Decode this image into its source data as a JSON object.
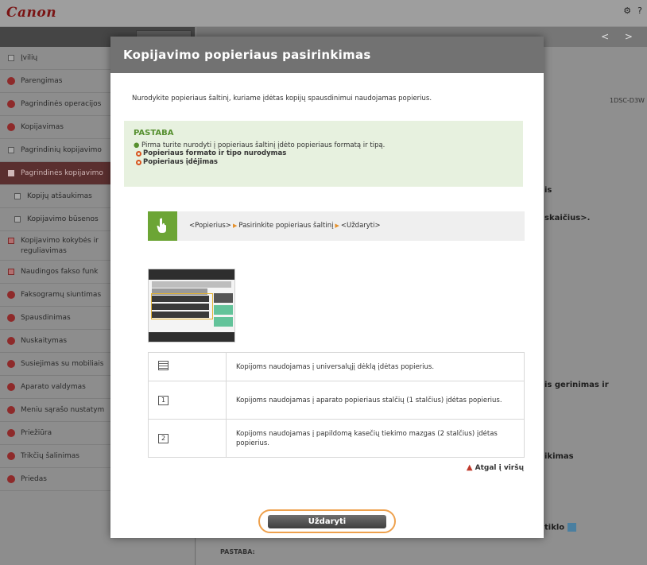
{
  "header": {
    "logo": "Canon",
    "settings_icon": "gear-icon",
    "help_label": "?"
  },
  "sidebar": {
    "items": [
      {
        "label": "Įvilių"
      },
      {
        "label": "Parengimas"
      },
      {
        "label": "Pagrindinės operacijos"
      },
      {
        "label": "Kopijavimas"
      },
      {
        "label": "Pagrindinių kopijavimo"
      },
      {
        "label": "Pagrindinės kopijavimo"
      },
      {
        "label": "Kopijų atšaukimas"
      },
      {
        "label": "Kopijavimo būsenos"
      },
      {
        "label": "Kopijavimo kokybės ir",
        "label2": "reguliavimas"
      },
      {
        "label": "Naudingos fakso funk"
      },
      {
        "label": "Faksogramų siuntimas"
      },
      {
        "label": "Spausdinimas"
      },
      {
        "label": "Nuskaitymas"
      },
      {
        "label": "Susiejimas su mobiliais"
      },
      {
        "label": "Aparato valdymas"
      },
      {
        "label": "Meniu sąrašo nustatym"
      },
      {
        "label": "Priežiūra"
      },
      {
        "label": "Trikčių šalinimas"
      },
      {
        "label": "Priedas"
      }
    ]
  },
  "background": {
    "nav_arrows": "< >",
    "model": "1DSC-D3W",
    "fragment1": "is",
    "fragment2": "skaičius>.",
    "fragment3": "is gerinimas ir",
    "fragment4": "ikimas",
    "fragment5": "tiklo",
    "fragment6": "PASTABA:"
  },
  "modal": {
    "title": "Kopijavimo popieriaus pasirinkimas",
    "intro": "Nurodykite popieriaus šaltinį, kuriame įdėtas kopijų spausdinimui naudojamas popierius.",
    "note": {
      "title": "PASTABA",
      "text": "Pirma turite nurodyti į popieriaus šaltinį įdėto popieriaus formatą ir tipą.",
      "links": [
        "Popieriaus formato ir tipo nurodymas",
        "Popieriaus įdėjimas"
      ]
    },
    "step": {
      "part1": "<Popierius>",
      "part2": "Pasirinkite popieriaus šaltinį",
      "part3": "<Uždaryti>"
    },
    "table": [
      {
        "icon": "multipurpose-tray-icon",
        "text": "Kopijoms naudojamas į universalųjį dėklą įdėtas popierius."
      },
      {
        "icon": "drawer-1-icon",
        "symbol": "1",
        "text": "Kopijoms naudojamas į aparato popieriaus stalčių (1 stalčius) įdėtas popierius."
      },
      {
        "icon": "drawer-2-icon",
        "symbol": "2",
        "text": "Kopijoms naudojamas į papildomą kasečių tiekimo mazgas (2 stalčius) įdėtas popierius."
      }
    ],
    "back_link": "Atgal į viršų",
    "close_label": "Uždaryti"
  },
  "colors": {
    "accent_green": "#6ca535",
    "note_bg": "#e7f1df",
    "highlight_orange": "#eea14d",
    "brand_red": "#7a1414"
  }
}
